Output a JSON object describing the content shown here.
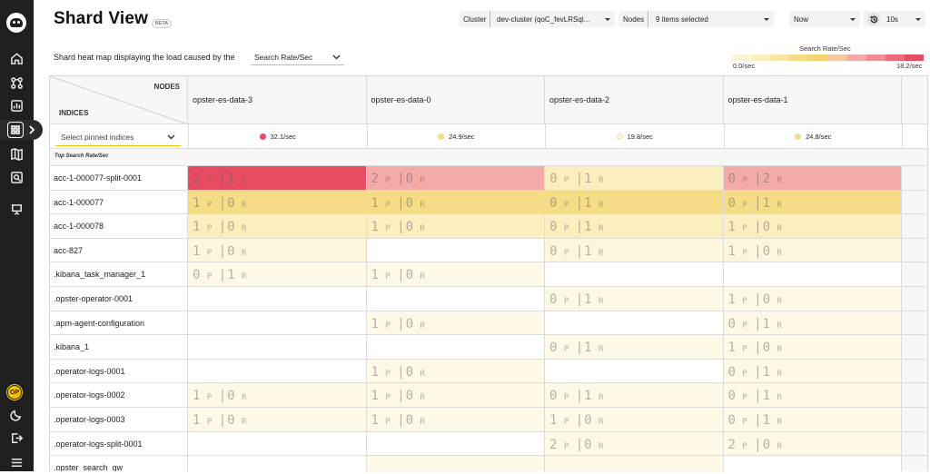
{
  "header": {
    "title": "Shard View",
    "beta": "BETA",
    "cluster_label": "Cluster",
    "cluster_value": "dev-cluster (qoC_fevLRSql...",
    "nodes_label": "Nodes",
    "nodes_value": "9 items selected",
    "time_value": "Now",
    "refresh_value": "10s"
  },
  "subheader": {
    "text": "Shard heat map displaying the load caused by the",
    "metric": "Search Rate/Sec",
    "legend_title": "Search Rate/Sec",
    "legend_min": "0.0/sec",
    "legend_max": "18.2/sec",
    "legend_colors": [
      "#fdf6d6",
      "#fbefbf",
      "#f9e6a0",
      "#f6dc86",
      "#f2d573",
      "#f6c9a6",
      "#f5aaaa",
      "#f18d95",
      "#ec6a7b",
      "#e84c62"
    ]
  },
  "table": {
    "corner_nodes": "NODES",
    "corner_indices": "INDICES",
    "pinned_placeholder": "Select pinned indices",
    "section_label": "Top Search Rate/Sec",
    "nodes": [
      {
        "name": "opster-es-data-3",
        "rate": "32.1/sec",
        "dot": "#e84c62"
      },
      {
        "name": "opster-es-data-0",
        "rate": "24.9/sec",
        "dot": "#f6dc86"
      },
      {
        "name": "opster-es-data-2",
        "rate": "19.8/sec",
        "dot": "#fdf6d6"
      },
      {
        "name": "opster-es-data-1",
        "rate": "24.8/sec",
        "dot": "#f6dc86"
      }
    ],
    "rows": [
      {
        "index": "acc-1-000077-split-0001",
        "cells": [
          {
            "p": "2",
            "r": "1",
            "bg": "#e84c62"
          },
          {
            "p": "2",
            "r": "0",
            "bg": "#f5aaaa"
          },
          {
            "p": "0",
            "r": "1",
            "bg": "#fbefbf"
          },
          {
            "p": "0",
            "r": "2",
            "bg": "#f5aaaa"
          }
        ]
      },
      {
        "index": "acc-1-000077",
        "cells": [
          {
            "p": "1",
            "r": "0",
            "bg": "#f6dc86"
          },
          {
            "p": "1",
            "r": "0",
            "bg": "#f6dc86"
          },
          {
            "p": "0",
            "r": "1",
            "bg": "#f6dc86"
          },
          {
            "p": "0",
            "r": "1",
            "bg": "#f6dc86"
          }
        ]
      },
      {
        "index": "acc-1-000078",
        "cells": [
          {
            "p": "1",
            "r": "0",
            "bg": "#fbefbf"
          },
          {
            "p": "1",
            "r": "0",
            "bg": "#fbefbf"
          },
          {
            "p": "0",
            "r": "1",
            "bg": "#fbefbf"
          },
          {
            "p": "1",
            "r": "0",
            "bg": "#fbefbf"
          }
        ]
      },
      {
        "index": "acc-827",
        "cells": [
          {
            "p": "1",
            "r": "0",
            "bg": "#fdf6dc"
          },
          null,
          {
            "p": "0",
            "r": "1",
            "bg": "#fdf6dc"
          },
          {
            "p": "1",
            "r": "0",
            "bg": "#fdf6dc"
          }
        ]
      },
      {
        "index": ".kibana_task_manager_1",
        "cells": [
          {
            "p": "0",
            "r": "1",
            "bg": "#fdf9e6"
          },
          {
            "p": "1",
            "r": "0",
            "bg": "#fdf9e6"
          },
          null,
          null
        ]
      },
      {
        "index": ".opster-operator-0001",
        "cells": [
          null,
          null,
          {
            "p": "0",
            "r": "1",
            "bg": "#fdf9e6"
          },
          {
            "p": "1",
            "r": "0",
            "bg": "#fdf9e6"
          }
        ]
      },
      {
        "index": ".apm-agent-configuration",
        "cells": [
          null,
          {
            "p": "1",
            "r": "0",
            "bg": "#fdf9e6"
          },
          null,
          {
            "p": "0",
            "r": "1",
            "bg": "#fdf9e6"
          }
        ]
      },
      {
        "index": ".kibana_1",
        "cells": [
          null,
          null,
          {
            "p": "0",
            "r": "1",
            "bg": "#fdf9e6"
          },
          {
            "p": "1",
            "r": "0",
            "bg": "#fdf9e6"
          }
        ]
      },
      {
        "index": ".operator-logs-0001",
        "cells": [
          null,
          {
            "p": "1",
            "r": "0",
            "bg": "#fdf9e6"
          },
          null,
          {
            "p": "0",
            "r": "1",
            "bg": "#fdf9e6"
          }
        ]
      },
      {
        "index": ".operator-logs-0002",
        "cells": [
          {
            "p": "1",
            "r": "0",
            "bg": "#fdf9e6"
          },
          {
            "p": "1",
            "r": "0",
            "bg": "#fdf9e6"
          },
          {
            "p": "0",
            "r": "1",
            "bg": "#fdf9e6"
          },
          {
            "p": "0",
            "r": "1",
            "bg": "#fdf9e6"
          }
        ]
      },
      {
        "index": ".operator-logs-0003",
        "cells": [
          {
            "p": "1",
            "r": "0",
            "bg": "#fdf9e6"
          },
          {
            "p": "1",
            "r": "0",
            "bg": "#fdf9e6"
          },
          {
            "p": "1",
            "r": "0",
            "bg": "#fdf9e6"
          },
          {
            "p": "0",
            "r": "1",
            "bg": "#fdf9e6"
          }
        ]
      },
      {
        "index": ".operator-logs-split-0001",
        "cells": [
          null,
          null,
          {
            "p": "2",
            "r": "0",
            "bg": "#fdf9e6"
          },
          {
            "p": "2",
            "r": "0",
            "bg": "#fdf9e6"
          }
        ]
      },
      {
        "index": ".opster_search_qw",
        "cells": [
          null,
          {
            "p": "",
            "r": "",
            "bg": "#fdf9e6"
          },
          {
            "p": "",
            "r": "",
            "bg": "#fdf9e6"
          },
          null
        ]
      }
    ]
  }
}
